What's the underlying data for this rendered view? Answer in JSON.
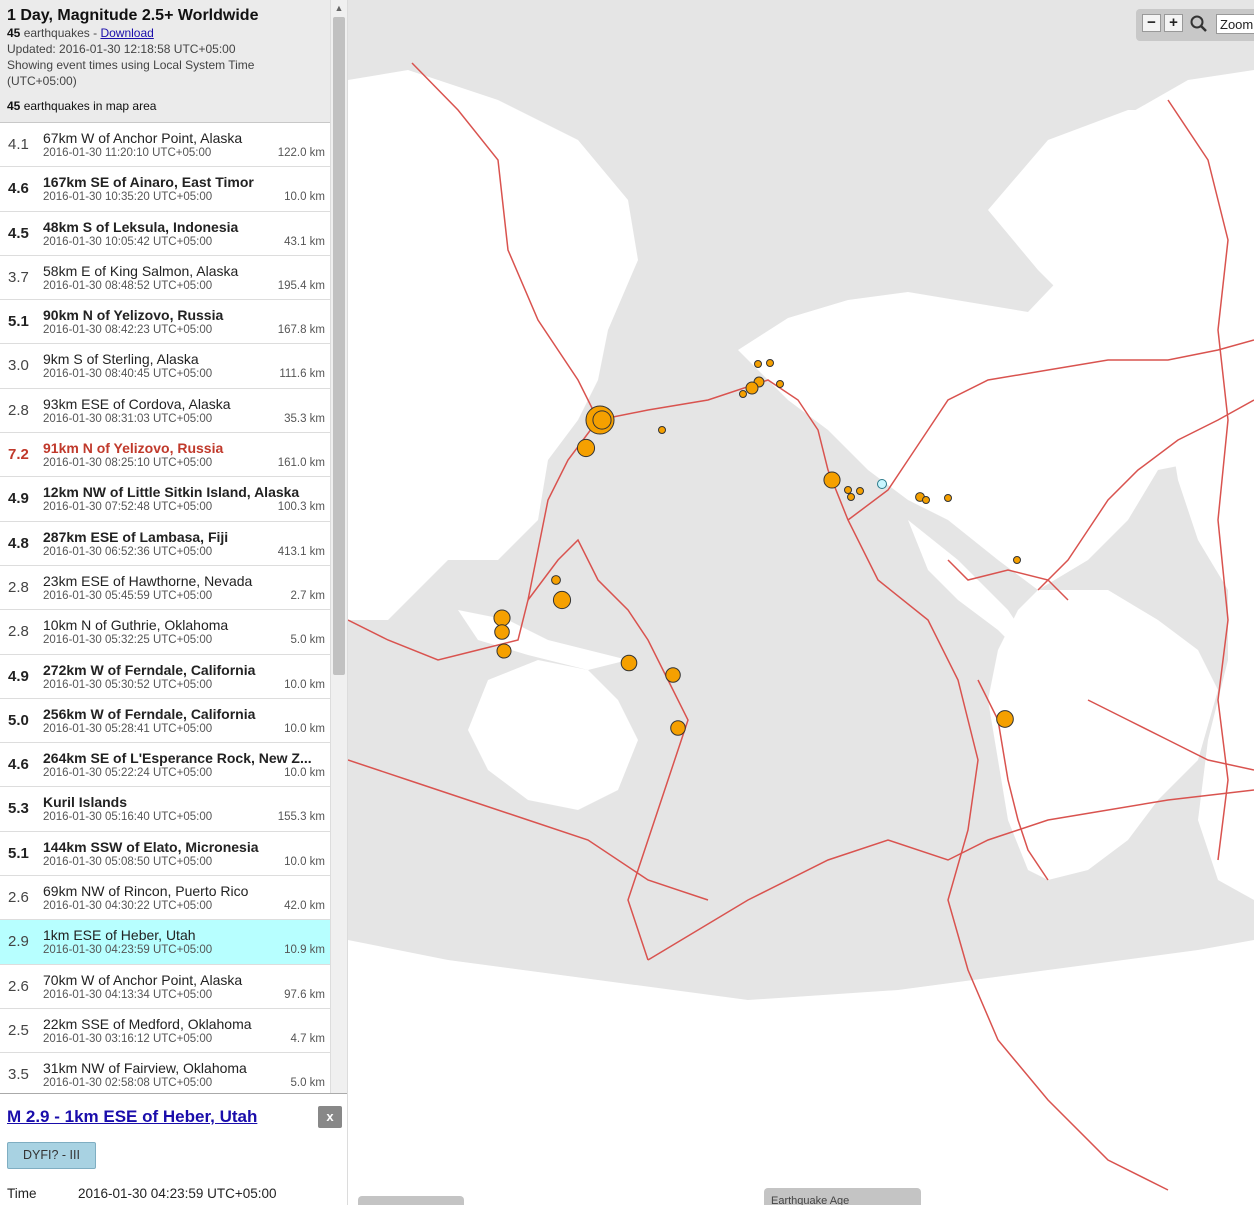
{
  "header": {
    "title": "1 Day, Magnitude 2.5+ Worldwide",
    "count_number": "45",
    "count_suffix": "earthquakes -",
    "download_label": "Download",
    "updated": "Updated: 2016-01-30 12:18:58 UTC+05:00",
    "time_note_1": "Showing event times using Local System Time",
    "time_note_2": "(UTC+05:00)",
    "map_area_number": "45",
    "map_area_suffix": "earthquakes in map area"
  },
  "quakes": [
    {
      "mag": "4.1",
      "place": "67km W of Anchor Point, Alaska",
      "time": "2016-01-30 11:20:10 UTC+05:00",
      "depth": "122.0 km",
      "style": "normal"
    },
    {
      "mag": "4.6",
      "place": "167km SE of Ainaro, East Timor",
      "time": "2016-01-30 10:35:20 UTC+05:00",
      "depth": "10.0 km",
      "style": "bold"
    },
    {
      "mag": "4.5",
      "place": "48km S of Leksula, Indonesia",
      "time": "2016-01-30 10:05:42 UTC+05:00",
      "depth": "43.1 km",
      "style": "bold"
    },
    {
      "mag": "3.7",
      "place": "58km E of King Salmon, Alaska",
      "time": "2016-01-30 08:48:52 UTC+05:00",
      "depth": "195.4 km",
      "style": "normal"
    },
    {
      "mag": "5.1",
      "place": "90km N of Yelizovo, Russia",
      "time": "2016-01-30 08:42:23 UTC+05:00",
      "depth": "167.8 km",
      "style": "bold"
    },
    {
      "mag": "3.0",
      "place": "9km S of Sterling, Alaska",
      "time": "2016-01-30 08:40:45 UTC+05:00",
      "depth": "111.6 km",
      "style": "normal"
    },
    {
      "mag": "2.8",
      "place": "93km ESE of Cordova, Alaska",
      "time": "2016-01-30 08:31:03 UTC+05:00",
      "depth": "35.3 km",
      "style": "normal"
    },
    {
      "mag": "7.2",
      "place": "91km N of Yelizovo, Russia",
      "time": "2016-01-30 08:25:10 UTC+05:00",
      "depth": "161.0 km",
      "style": "major"
    },
    {
      "mag": "4.9",
      "place": "12km NW of Little Sitkin Island, Alaska",
      "time": "2016-01-30 07:52:48 UTC+05:00",
      "depth": "100.3 km",
      "style": "bold"
    },
    {
      "mag": "4.8",
      "place": "287km ESE of Lambasa, Fiji",
      "time": "2016-01-30 06:52:36 UTC+05:00",
      "depth": "413.1 km",
      "style": "bold"
    },
    {
      "mag": "2.8",
      "place": "23km ESE of Hawthorne, Nevada",
      "time": "2016-01-30 05:45:59 UTC+05:00",
      "depth": "2.7 km",
      "style": "normal"
    },
    {
      "mag": "2.8",
      "place": "10km N of Guthrie, Oklahoma",
      "time": "2016-01-30 05:32:25 UTC+05:00",
      "depth": "5.0 km",
      "style": "normal"
    },
    {
      "mag": "4.9",
      "place": "272km W of Ferndale, California",
      "time": "2016-01-30 05:30:52 UTC+05:00",
      "depth": "10.0 km",
      "style": "bold"
    },
    {
      "mag": "5.0",
      "place": "256km W of Ferndale, California",
      "time": "2016-01-30 05:28:41 UTC+05:00",
      "depth": "10.0 km",
      "style": "bold"
    },
    {
      "mag": "4.6",
      "place": "264km SE of L'Esperance Rock, New Z...",
      "time": "2016-01-30 05:22:24 UTC+05:00",
      "depth": "10.0 km",
      "style": "bold"
    },
    {
      "mag": "5.3",
      "place": "Kuril Islands",
      "time": "2016-01-30 05:16:40 UTC+05:00",
      "depth": "155.3 km",
      "style": "bold"
    },
    {
      "mag": "5.1",
      "place": "144km SSW of Elato, Micronesia",
      "time": "2016-01-30 05:08:50 UTC+05:00",
      "depth": "10.0 km",
      "style": "bold"
    },
    {
      "mag": "2.6",
      "place": "69km NW of Rincon, Puerto Rico",
      "time": "2016-01-30 04:30:22 UTC+05:00",
      "depth": "42.0 km",
      "style": "normal"
    },
    {
      "mag": "2.9",
      "place": "1km ESE of Heber, Utah",
      "time": "2016-01-30 04:23:59 UTC+05:00",
      "depth": "10.9 km",
      "style": "selected"
    },
    {
      "mag": "2.6",
      "place": "70km W of Anchor Point, Alaska",
      "time": "2016-01-30 04:13:34 UTC+05:00",
      "depth": "97.6 km",
      "style": "normal"
    },
    {
      "mag": "2.5",
      "place": "22km SSE of Medford, Oklahoma",
      "time": "2016-01-30 03:16:12 UTC+05:00",
      "depth": "4.7 km",
      "style": "normal"
    },
    {
      "mag": "3.5",
      "place": "31km NW of Fairview, Oklahoma",
      "time": "2016-01-30 02:58:08 UTC+05:00",
      "depth": "5.0 km",
      "style": "normal"
    }
  ],
  "detail": {
    "title": "M 2.9 - 1km ESE of Heber, Utah",
    "close_label": "x",
    "dyfi_label": "DYFI? - III",
    "time_label": "Time",
    "time_value": "2016-01-30 04:23:59 UTC+05:00"
  },
  "map": {
    "zoom_in_label": "+",
    "zoom_out_label": "−",
    "zoom_input_value": "Zoom",
    "age_legend_label": "Earthquake Age",
    "colors": {
      "ocean": "#e5e5e5",
      "land": "#ffffff",
      "plate_boundary": "#d9534f",
      "quake_fill": "#f5a000",
      "quake_stroke": "#333333",
      "selected_fill": "#c8f6ff"
    }
  }
}
